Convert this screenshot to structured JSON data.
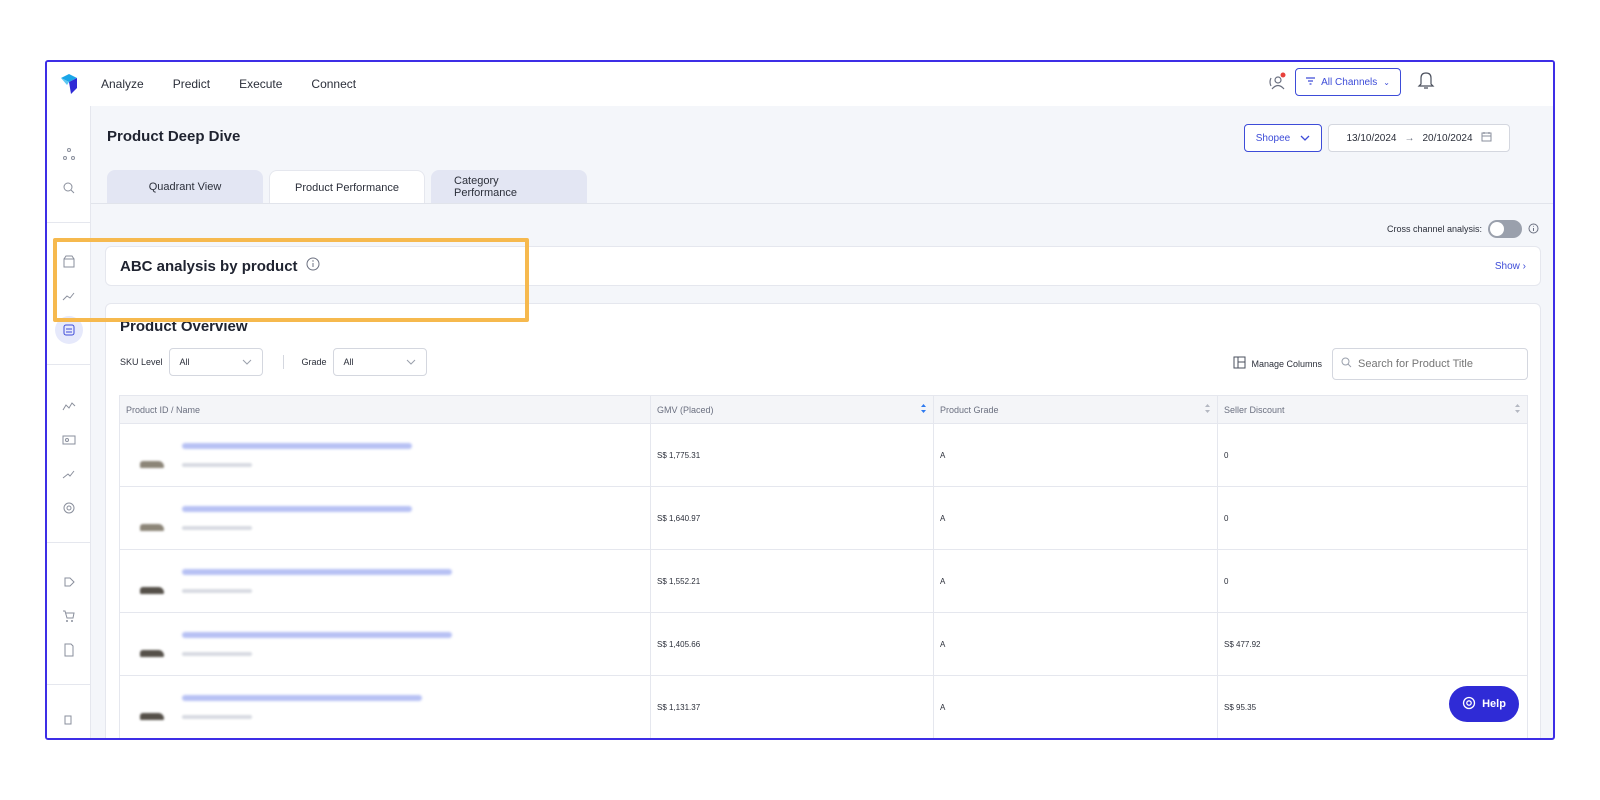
{
  "topbar": {
    "nav": [
      "Analyze",
      "Predict",
      "Execute",
      "Connect"
    ],
    "channel_label": "All Channels"
  },
  "page": {
    "title": "Product Deep Dive",
    "marketplace": "Shopee",
    "date_from": "13/10/2024",
    "date_to": "20/10/2024",
    "tabs": [
      {
        "label": "Quadrant View",
        "active": false
      },
      {
        "label": "Product Performance",
        "active": true
      },
      {
        "label": "Category Performance",
        "active": false
      }
    ],
    "cross_channel_label": "Cross channel analysis:"
  },
  "abc": {
    "title": "ABC analysis by product",
    "show_label": "Show"
  },
  "overview": {
    "title": "Product Overview",
    "sku_label": "SKU Level",
    "sku_value": "All",
    "grade_label": "Grade",
    "grade_value": "All",
    "manage_label": "Manage Columns",
    "search_placeholder": "Search for Product Title"
  },
  "table": {
    "headers": [
      "Product ID / Name",
      "GMV (Placed)",
      "Product Grade",
      "Seller Discount"
    ],
    "rows": [
      {
        "gmv": "S$ 1,775.31",
        "grade": "A",
        "discount": "0"
      },
      {
        "gmv": "S$ 1,640.97",
        "grade": "A",
        "discount": "0"
      },
      {
        "gmv": "S$ 1,552.21",
        "grade": "A",
        "discount": "0"
      },
      {
        "gmv": "S$ 1,405.66",
        "grade": "A",
        "discount": "S$ 477.92"
      },
      {
        "gmv": "S$ 1,131.37",
        "grade": "A",
        "discount": "S$ 95.35"
      }
    ]
  },
  "help_label": "Help",
  "colors": {
    "accent": "#3d4cd8",
    "frame": "#3d2ee6",
    "highlight": "#f6b94e",
    "help_bg": "#2f2bd6"
  }
}
